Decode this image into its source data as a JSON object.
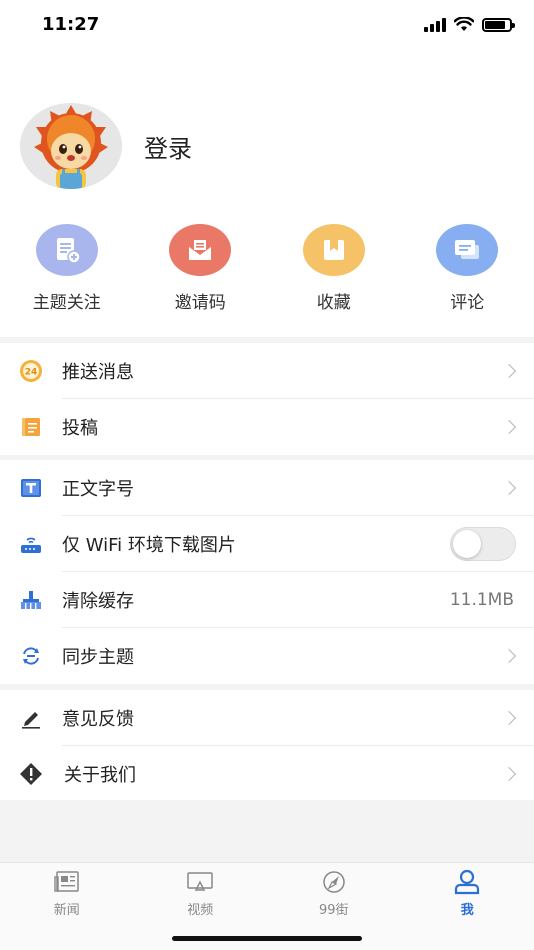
{
  "status_bar": {
    "time": "11:27",
    "battery_level": 0.85
  },
  "profile": {
    "login_label": "登录"
  },
  "quick_actions": [
    {
      "label": "主题关注",
      "icon": "topic-follow-icon",
      "color": "#a9b6ee"
    },
    {
      "label": "邀请码",
      "icon": "invite-code-icon",
      "color": "#ea7866"
    },
    {
      "label": "收藏",
      "icon": "favorites-icon",
      "color": "#f5c267"
    },
    {
      "label": "评论",
      "icon": "comments-icon",
      "color": "#86aef0"
    }
  ],
  "menu": {
    "push_messages": {
      "label": "推送消息",
      "icon": "push-24-icon"
    },
    "contribute": {
      "label": "投稿",
      "icon": "notebook-icon"
    },
    "font_size": {
      "label": "正文字号",
      "icon": "text-size-icon"
    },
    "wifi_only_images": {
      "label": "仅 WiFi 环境下载图片",
      "icon": "router-icon",
      "enabled": false
    },
    "clear_cache": {
      "label": "清除缓存",
      "icon": "broom-icon",
      "value": "11.1MB"
    },
    "sync_topics": {
      "label": "同步主题",
      "icon": "sync-icon"
    },
    "feedback": {
      "label": "意见反馈",
      "icon": "pen-icon"
    },
    "about": {
      "label": "关于我们",
      "icon": "info-diamond-icon"
    }
  },
  "tabs": [
    {
      "label": "新闻",
      "icon": "newspaper-icon",
      "active": false
    },
    {
      "label": "视频",
      "icon": "tv-icon",
      "active": false
    },
    {
      "label": "99街",
      "icon": "compass-icon",
      "active": false
    },
    {
      "label": "我",
      "icon": "person-icon",
      "active": true
    }
  ],
  "colors": {
    "accent": "#2b6fd6",
    "section_bg": "#f3f3f3"
  }
}
